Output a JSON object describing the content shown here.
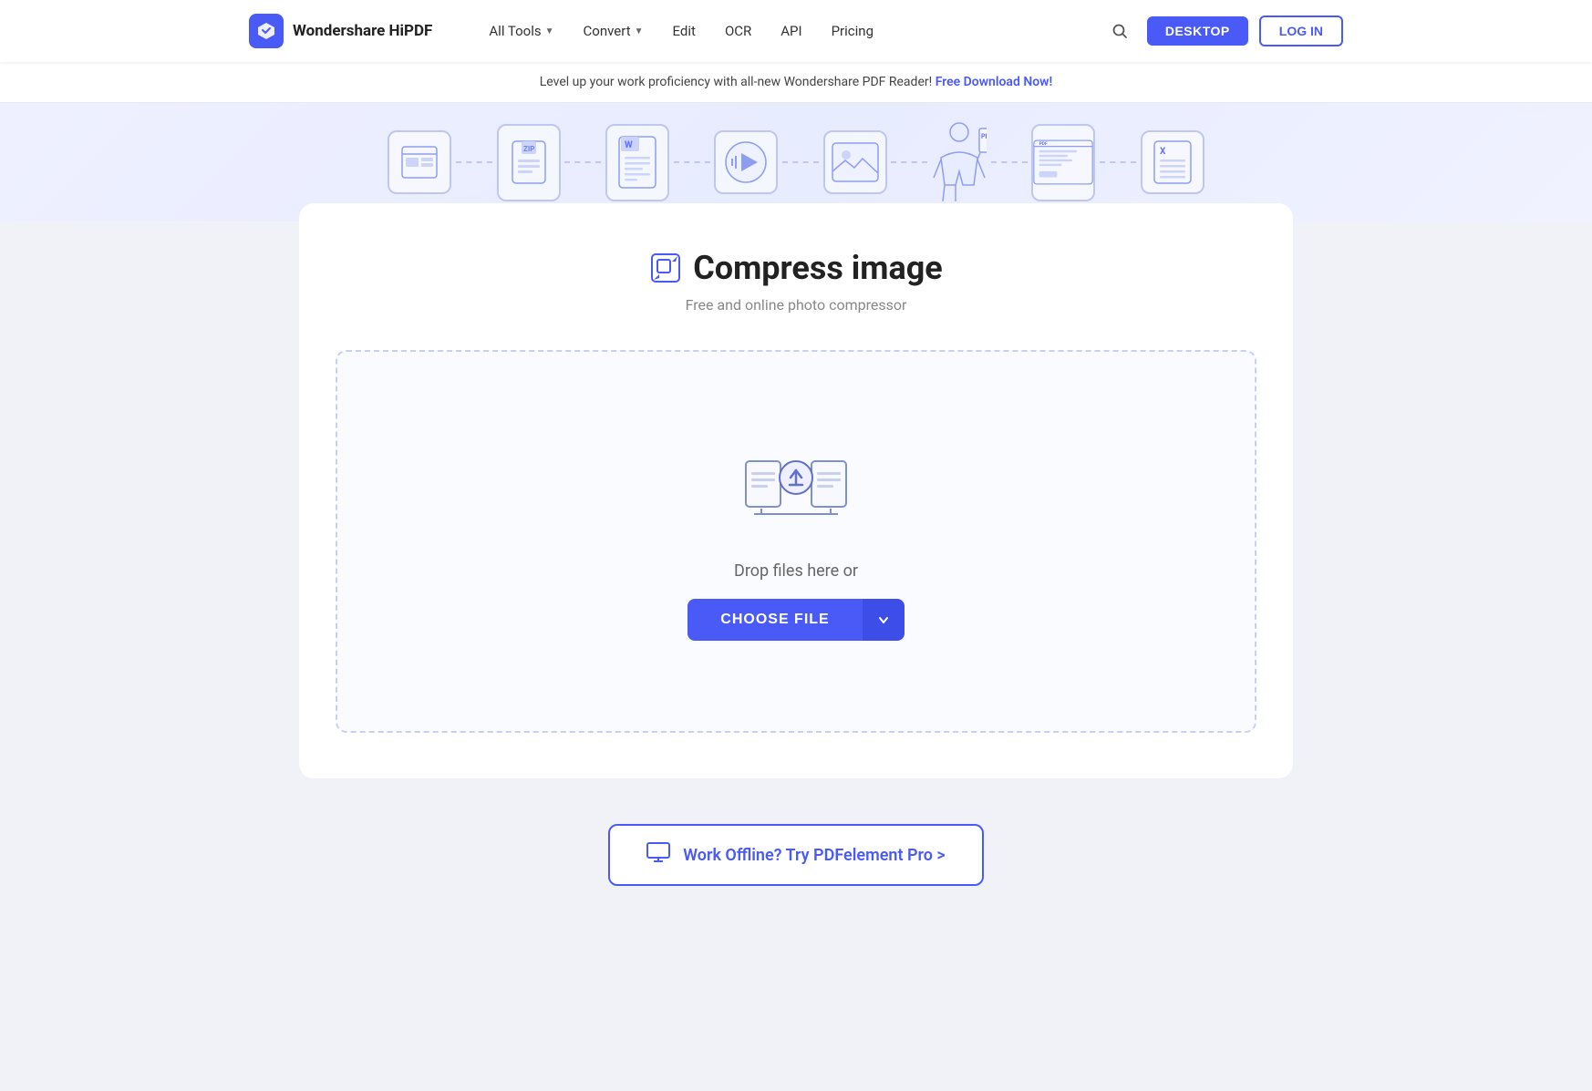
{
  "brand": {
    "name": "Wondershare HiPDF"
  },
  "nav": {
    "items": [
      {
        "label": "All Tools",
        "hasDropdown": true
      },
      {
        "label": "Convert",
        "hasDropdown": true
      },
      {
        "label": "Edit",
        "hasDropdown": false
      },
      {
        "label": "OCR",
        "hasDropdown": false
      },
      {
        "label": "API",
        "hasDropdown": false
      },
      {
        "label": "Pricing",
        "hasDropdown": false
      }
    ],
    "desktop_btn": "DESKTOP",
    "login_btn": "LOG IN"
  },
  "banner": {
    "text": "Level up your work proficiency with all-new Wondershare PDF Reader!",
    "link_text": "Free Download Now!"
  },
  "tool": {
    "title": "Compress image",
    "subtitle": "Free and online photo compressor",
    "drop_text": "Drop files here or",
    "choose_file_label": "CHOOSE FILE"
  },
  "offline": {
    "text": "Work Offline? Try PDFelement Pro >"
  }
}
